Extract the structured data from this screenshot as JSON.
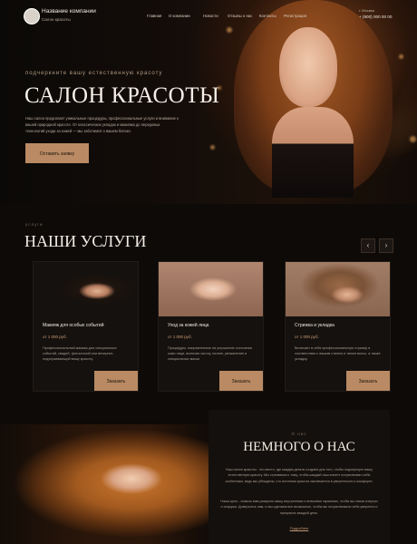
{
  "header": {
    "company_name": "Название компании",
    "company_sub": "Салон красоты",
    "nav": [
      "Главная",
      "О компании",
      "Новости",
      "Отзывы о нас",
      "Контакты",
      "Регистрация"
    ],
    "city": "г. Москва",
    "phone": "+ (900) 000 00 00"
  },
  "hero": {
    "tagline": "подчеркните вашу естественную красоту",
    "title": "САЛОН КРАСОТЫ",
    "description": "Наш салон предлагает уникальные процедуры, профессиональные услуги и внимание к вашей природной красоте. От классических укладок и макияжа до передовых технологий ухода за кожей — мы заботимся о вашем блеске.",
    "button": "Оставить заявку"
  },
  "services": {
    "eyebrow": "услуги",
    "title": "НАШИ УСЛУГИ",
    "prev_icon": "‹",
    "next_icon": "›",
    "cards": [
      {
        "name": "Макияж для особых событий",
        "price": "от 1 000 руб.",
        "description": "Профессиональный макияж для специальных событий, свадеб, фотосессий или вечерних, подчеркивающий вашу красоту.",
        "button": "Заказать"
      },
      {
        "name": "Уход за кожей лица",
        "price": "от 1 000 руб.",
        "description": "Процедуры, направленные на улучшение состояния кожи лица, включая чистку, пилинг, увлажнение и специальные маски",
        "button": "Заказать"
      },
      {
        "name": "Стрижка и укладка",
        "price": "от 1 000 руб.",
        "description": "Включает в себя профессиональную стрижку в соответствии с вашим стилем и типом волос, а также укладку.",
        "button": "Заказать"
      }
    ]
  },
  "about": {
    "eyebrow": "О нас",
    "title": "НЕМНОГО О НАС",
    "paragraph1": "Наш салон красоты - это место, где каждая деталь создана для того, чтобы подчеркнуть вашу естественную красоту. Мы стремимся к тому, чтобы каждый наш клиент почувствовал себя особенным, ведь мы убеждены, что истинная красота заключается в уверенности и комфорте.",
    "paragraph2": "Наша цель - помочь вам раскрыть вашу внутреннюю и внешнюю гармонию, чтобы вы сияли изнутри и снаружи. Доверьтесь нам, и мы сделаем все возможное, чтобы вы почувствовали себя уверенно и прекрасно каждый день.",
    "link": "Подробнее"
  },
  "colors": {
    "background": "#0d0a08",
    "accent": "#b98a63",
    "card": "#14110f"
  }
}
